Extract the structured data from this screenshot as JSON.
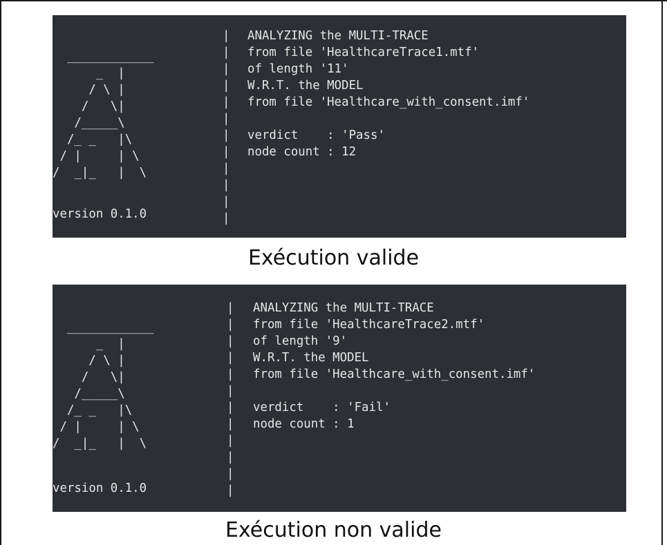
{
  "panels": [
    {
      "art": "  ____________\n      _  |\n     / \\ |\n    /   \\|\n   /_____\\\n  /_ _   |\\\n / |     | \\\n/  _|_   |  \\",
      "separator": "|\n|\n|\n|\n|\n|\n|\n|\n|\n|\n|\n|",
      "info_lines": [
        "ANALYZING the MULTI-TRACE",
        "from file 'HealthcareTrace1.mtf'",
        "of length '11'",
        "W.R.T. the MODEL",
        "from file 'Healthcare_with_consent.imf'",
        "",
        "verdict    : 'Pass'",
        "node count : 12"
      ],
      "version": "version 0.1.0",
      "caption": "Exécution valide"
    },
    {
      "art": "  ____________\n      _  |\n     / \\ |\n    /   \\|\n   /_____\\\n  /_ _   |\\\n / |     | \\\n/  _|_   |  \\",
      "separator": "|\n|\n|\n|\n|\n|\n|\n|\n|\n|\n|\n|",
      "info_lines": [
        "ANALYZING the MULTI-TRACE",
        "from file 'HealthcareTrace2.mtf'",
        "of length '9'",
        "W.R.T. the MODEL",
        "from file 'Healthcare_with_consent.imf'",
        "",
        "verdict    : 'Fail'",
        "node count : 1"
      ],
      "version": "version 0.1.0",
      "caption": "Exécution non valide"
    }
  ],
  "colors": {
    "terminal_bg": "#2c2f33",
    "terminal_fg": "#e6e6e6",
    "caption_fg": "#111111"
  }
}
